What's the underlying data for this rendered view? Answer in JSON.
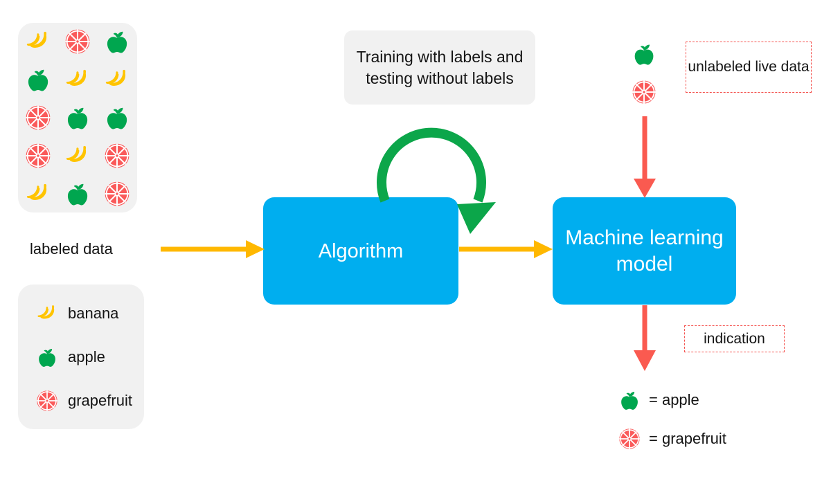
{
  "diagram": {
    "title": "Supervised machine learning workflow with fruit classification",
    "colors": {
      "panel_bg": "#f1f1f1",
      "process_box": "#00AEEF",
      "arrow_yellow": "#FFB800",
      "arrow_red": "#FA5A50",
      "arrow_green": "#0CA64A",
      "banana": "#FFC400",
      "apple": "#00A64F",
      "grapefruit": "#FA5A5A",
      "text": "#141414"
    }
  },
  "labeled_data": {
    "panel_label": "labeled data",
    "grid": [
      [
        "banana",
        "grapefruit",
        "apple"
      ],
      [
        "apple",
        "banana",
        "banana"
      ],
      [
        "grapefruit",
        "apple",
        "apple"
      ],
      [
        "grapefruit",
        "banana",
        "grapefruit"
      ],
      [
        "banana",
        "apple",
        "grapefruit"
      ]
    ]
  },
  "legend": {
    "items": [
      {
        "icon": "banana-icon",
        "label": "banana"
      },
      {
        "icon": "apple-icon",
        "label": "apple"
      },
      {
        "icon": "grapefruit-icon",
        "label": "grapefruit"
      }
    ]
  },
  "training_note": {
    "text": "Training with labels and testing without labels"
  },
  "process": {
    "algorithm_label": "Algorithm",
    "model_label": "Machine learning model"
  },
  "live_data": {
    "note": "unlabeled live data",
    "fruits": [
      "apple",
      "grapefruit"
    ]
  },
  "output": {
    "note": "indication",
    "items": [
      {
        "icon": "apple-icon",
        "label": "= apple"
      },
      {
        "icon": "grapefruit-icon",
        "label": "= grapefruit"
      }
    ]
  },
  "arrows": [
    {
      "name": "labeled-data-to-algorithm",
      "color": "#FFB800",
      "direction": "right"
    },
    {
      "name": "algorithm-to-model",
      "color": "#FFB800",
      "direction": "right"
    },
    {
      "name": "algorithm-self-loop",
      "color": "#0CA64A",
      "direction": "curved"
    },
    {
      "name": "live-data-to-model",
      "color": "#FA5A50",
      "direction": "down"
    },
    {
      "name": "model-to-output",
      "color": "#FA5A50",
      "direction": "down"
    }
  ]
}
